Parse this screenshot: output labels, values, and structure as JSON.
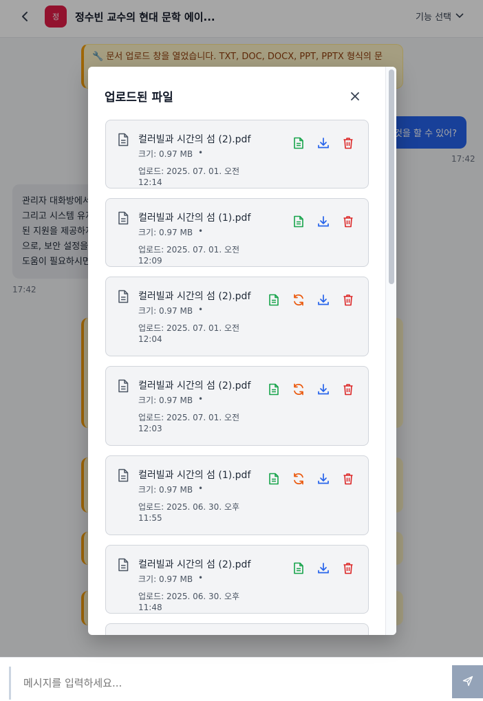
{
  "header": {
    "avatar_text": "정",
    "title": "정수빈 교수의 현대 문학 에이...",
    "function_select": "기능 선택"
  },
  "chat": {
    "system_message": "🔧 문서 업로드 창을 열었습니다. TXT, DOC, DOCX, PPT, PPTX 형식의 문",
    "user_message": "것을 할 수 있어?",
    "user_time": "17:42",
    "bot_lines": [
      "관리자 대화방에서",
      "그리고 시스템 유지",
      "된 지원을 제공하지",
      "으로, 보안 설정을",
      "도움이 필요하시면"
    ],
    "bot_time": "17:42"
  },
  "input": {
    "placeholder": "메시지를 입력하세요..."
  },
  "modal": {
    "title": "업로드된 파일",
    "files": [
      {
        "name": "컬러빌과 시간의 섬 (2).pdf",
        "size": "크기: 0.97 MB",
        "date": "업로드: 2025. 07. 01. 오전 12:14",
        "reprocess": false
      },
      {
        "name": "컬러빌과 시간의 섬 (1).pdf",
        "size": "크기: 0.97 MB",
        "date": "업로드: 2025. 07. 01. 오전 12:09",
        "reprocess": false
      },
      {
        "name": "컬러빌과 시간의 섬 (2).pdf",
        "size": "크기: 0.97 MB",
        "date": "업로드: 2025. 07. 01. 오전 12:04",
        "reprocess": true
      },
      {
        "name": "컬러빌과 시간의 섬 (2).pdf",
        "size": "크기: 0.97 MB",
        "date": "업로드: 2025. 07. 01. 오전 12:03",
        "reprocess": true
      },
      {
        "name": "컬러빌과 시간의 섬 (1).pdf",
        "size": "크기: 0.97 MB",
        "date": "업로드: 2025. 06. 30. 오후 11:55",
        "reprocess": true
      },
      {
        "name": "컬러빌과 시간의 섬 (2).pdf",
        "size": "크기: 0.97 MB",
        "date": "업로드: 2025. 06. 30. 오후 11:48",
        "reprocess": false
      }
    ]
  },
  "colors": {
    "view_green": "#16a34a",
    "reprocess_orange": "#ea580c",
    "download_blue": "#2563eb",
    "delete_red": "#dc2626"
  }
}
